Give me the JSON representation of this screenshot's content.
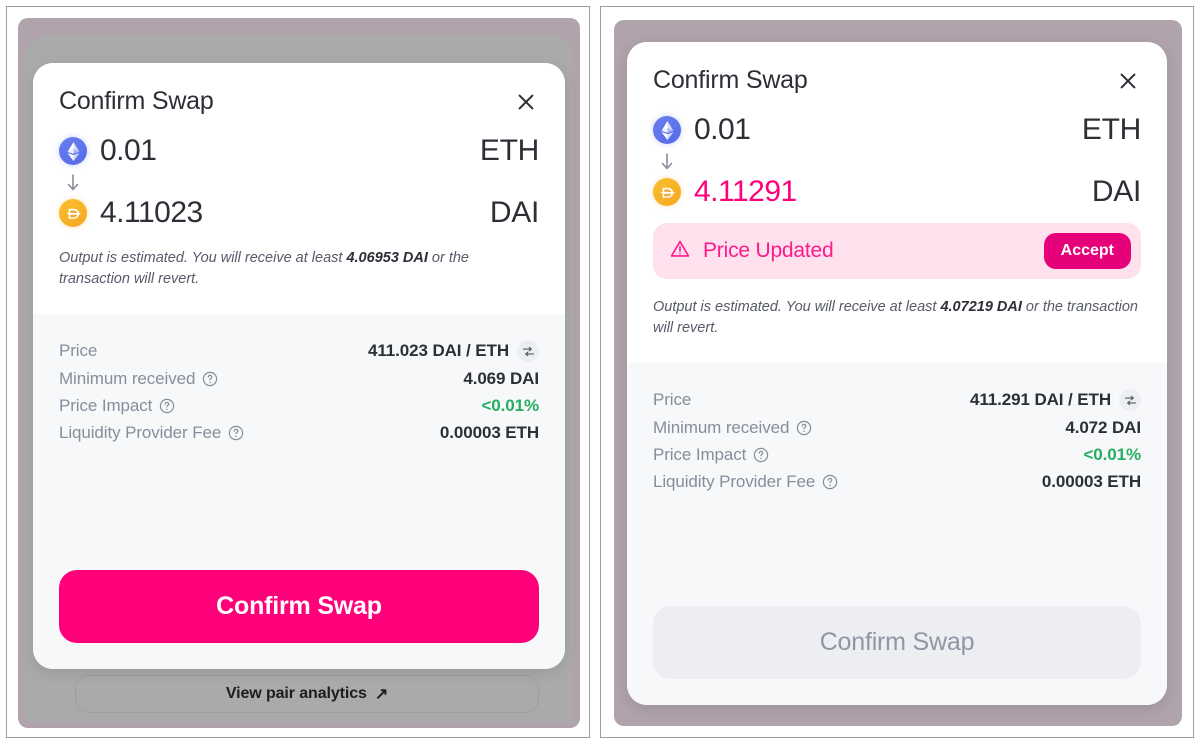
{
  "app": {
    "accent_pink": "#ff007a",
    "accent_pink_dark": "#e6007a",
    "banner_bg": "#ffe1ee",
    "green": "#27ae60",
    "panel_backdrop": "#b0a3ac",
    "scrim": "#aaaaaa",
    "details_bg": "#f7f8fa",
    "eth_icon_color": "#627eea",
    "dai_icon_color": "#f5ac37"
  },
  "panels": [
    {
      "id": "left",
      "modal": {
        "title": "Confirm Swap",
        "close_label": "✕",
        "from": {
          "icon": "eth-token-icon",
          "amount": "0.01",
          "symbol": "ETH",
          "updated": false
        },
        "arrow": "↓",
        "to": {
          "icon": "dai-token-icon",
          "amount": "4.11023",
          "symbol": "DAI",
          "updated": false
        },
        "price_banner": null,
        "estimate_note": {
          "prefix": "Output is estimated. You will receive at least ",
          "amount": "4.06953 DAI",
          "suffix": " or the transaction will revert."
        },
        "details": [
          {
            "label": "Price",
            "value": "411.023 DAI / ETH",
            "help": false,
            "swap_icon": true,
            "style": "normal"
          },
          {
            "label": "Minimum received",
            "value": "4.069 DAI",
            "help": true,
            "swap_icon": false,
            "style": "normal"
          },
          {
            "label": "Price Impact",
            "value": "<0.01%",
            "help": true,
            "swap_icon": false,
            "style": "positive"
          },
          {
            "label": "Liquidity Provider Fee",
            "value": "0.00003 ETH",
            "help": true,
            "swap_icon": false,
            "style": "normal"
          }
        ],
        "confirm_button": {
          "label": "Confirm Swap",
          "state": "enabled"
        }
      },
      "analytics_link": {
        "label": "View pair analytics",
        "icon": "↗"
      }
    },
    {
      "id": "right",
      "modal": {
        "title": "Confirm Swap",
        "close_label": "✕",
        "from": {
          "icon": "eth-token-icon",
          "amount": "0.01",
          "symbol": "ETH",
          "updated": false
        },
        "arrow": "↓",
        "to": {
          "icon": "dai-token-icon",
          "amount": "4.11291",
          "symbol": "DAI",
          "updated": true
        },
        "price_banner": {
          "icon": "warning-triangle-icon",
          "text": "Price Updated",
          "accept_label": "Accept"
        },
        "estimate_note": {
          "prefix": "Output is estimated. You will receive at least ",
          "amount": "4.07219 DAI",
          "suffix": " or the transaction will revert."
        },
        "details": [
          {
            "label": "Price",
            "value": "411.291 DAI / ETH",
            "help": false,
            "swap_icon": true,
            "style": "normal"
          },
          {
            "label": "Minimum received",
            "value": "4.072 DAI",
            "help": true,
            "swap_icon": false,
            "style": "normal"
          },
          {
            "label": "Price Impact",
            "value": "<0.01%",
            "help": true,
            "swap_icon": false,
            "style": "positive"
          },
          {
            "label": "Liquidity Provider Fee",
            "value": "0.00003 ETH",
            "help": true,
            "swap_icon": false,
            "style": "normal"
          }
        ],
        "confirm_button": {
          "label": "Confirm Swap",
          "state": "disabled"
        }
      },
      "analytics_link": null
    }
  ]
}
